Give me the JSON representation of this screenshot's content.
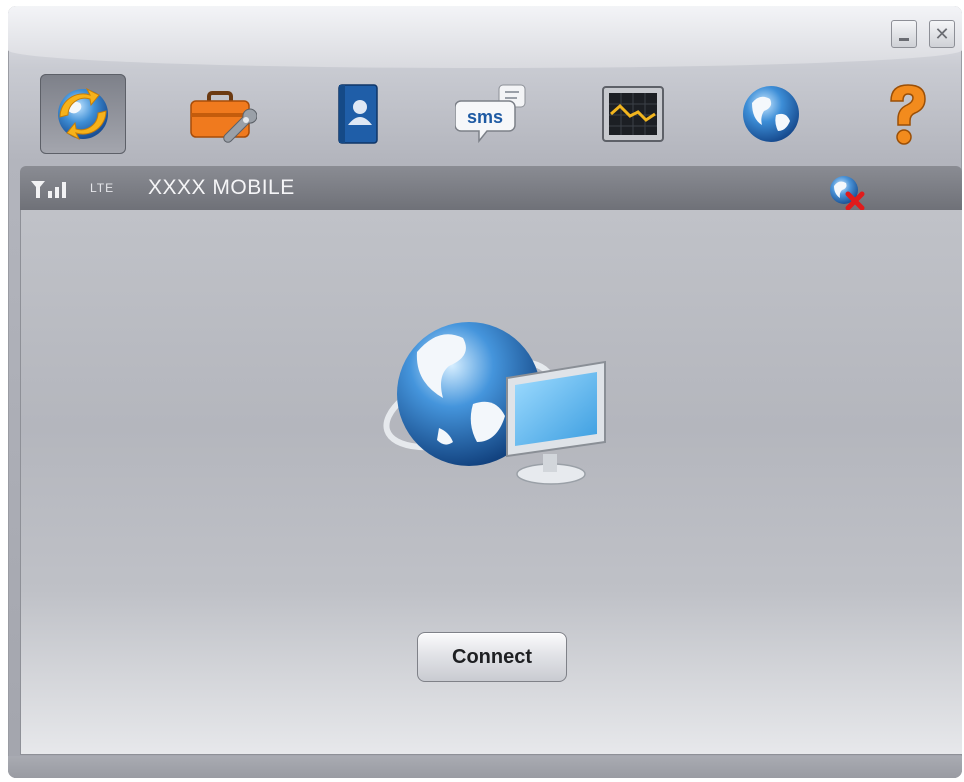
{
  "window": {
    "minimize_icon": "minimize-icon",
    "close_icon": "close-icon"
  },
  "toolbar": {
    "items": [
      {
        "name": "connection",
        "icon": "connection-sync-globe-icon",
        "active": true
      },
      {
        "name": "tools",
        "icon": "toolbox-icon",
        "active": false
      },
      {
        "name": "contacts",
        "icon": "contacts-book-icon",
        "active": false
      },
      {
        "name": "sms",
        "icon": "sms-bubble-icon",
        "label": "sms",
        "active": false
      },
      {
        "name": "statistics",
        "icon": "statistics-chart-icon",
        "active": false
      },
      {
        "name": "internet",
        "icon": "globe-icon",
        "active": false
      },
      {
        "name": "help",
        "icon": "help-question-icon",
        "active": false
      }
    ]
  },
  "status": {
    "signal_icon": "signal-strength-icon",
    "network_type": "LTE",
    "carrier": "XXXX MOBILE",
    "connection_state_icon": "disconnected-globe-icon"
  },
  "main": {
    "hero_icon": "globe-computer-icon",
    "connect_label": "Connect"
  },
  "colors": {
    "status_bar": "#7c7e85",
    "panel": "#babcc2",
    "accent_orange": "#f08a1c",
    "accent_blue": "#2f6fb8"
  }
}
